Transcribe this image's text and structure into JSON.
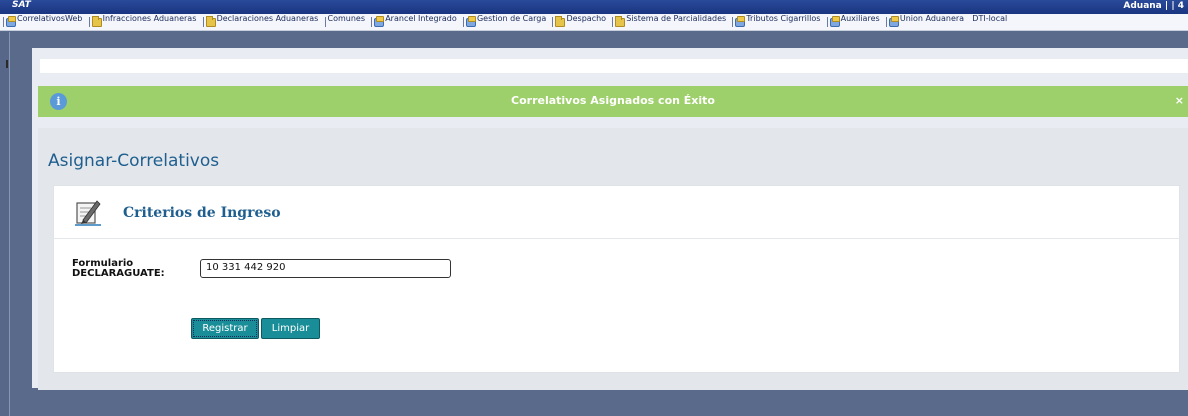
{
  "app": {
    "brand": "SAT",
    "top_right": "Aduana | | 4"
  },
  "menu": {
    "items": [
      {
        "label": "CorrelativosWeb",
        "icon": "gear-icon"
      },
      {
        "label": "Infracciones Aduaneras",
        "icon": "folder-icon"
      },
      {
        "label": "Declaraciones Aduaneras",
        "icon": "folder-icon"
      },
      {
        "label": "Comunes",
        "icon": ""
      },
      {
        "label": "Arancel Integrado",
        "icon": "gear-icon"
      },
      {
        "label": "Gestion de Carga",
        "icon": "gear-icon"
      },
      {
        "label": "Despacho",
        "icon": "folder-icon"
      },
      {
        "label": "Sistema de Parcialidades",
        "icon": "folder-icon"
      },
      {
        "label": "Tributos Cigarrillos",
        "icon": "gear-icon"
      },
      {
        "label": "Auxiliares",
        "icon": "gear-icon"
      },
      {
        "label": "Union Aduanera",
        "icon": "gear-icon"
      },
      {
        "label": "DTI-local",
        "icon": ""
      }
    ]
  },
  "alert": {
    "icon": "info-icon",
    "info_glyph": "i",
    "message": "Correlativos Asignados con Éxito",
    "close_label": "×",
    "color": "#9dcf6a"
  },
  "page": {
    "title": "Asignar-Correlativos"
  },
  "form": {
    "section_title": "Criterios de Ingreso",
    "section_icon": "edit-form-icon",
    "field_label_line1": "Formulario",
    "field_label_line2": "DECLARAGUATE:",
    "field_value": "10 331 442 920",
    "register_label": "Registrar",
    "clear_label": "Limpiar",
    "button_color": "#1a8e98"
  }
}
